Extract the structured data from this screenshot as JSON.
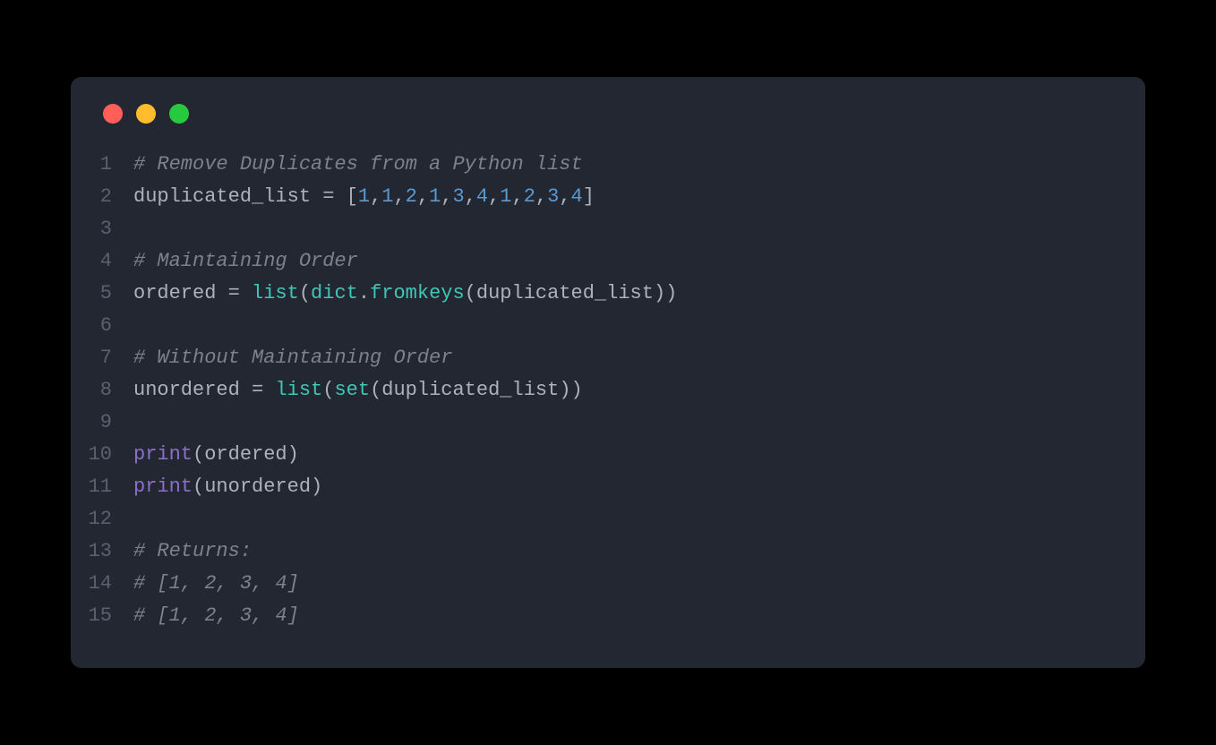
{
  "window": {
    "dots": [
      "red",
      "yellow",
      "green"
    ]
  },
  "code": {
    "lines": [
      {
        "num": "1",
        "tokens": [
          {
            "text": "# Remove Duplicates from a Python list",
            "cls": "tok-comment"
          }
        ]
      },
      {
        "num": "2",
        "tokens": [
          {
            "text": "duplicated_list",
            "cls": "tok-default"
          },
          {
            "text": " ",
            "cls": "tok-default"
          },
          {
            "text": "=",
            "cls": "tok-operator"
          },
          {
            "text": " ",
            "cls": "tok-default"
          },
          {
            "text": "[",
            "cls": "tok-punct"
          },
          {
            "text": "1",
            "cls": "tok-number"
          },
          {
            "text": ",",
            "cls": "tok-punct"
          },
          {
            "text": "1",
            "cls": "tok-number"
          },
          {
            "text": ",",
            "cls": "tok-punct"
          },
          {
            "text": "2",
            "cls": "tok-number"
          },
          {
            "text": ",",
            "cls": "tok-punct"
          },
          {
            "text": "1",
            "cls": "tok-number"
          },
          {
            "text": ",",
            "cls": "tok-punct"
          },
          {
            "text": "3",
            "cls": "tok-number"
          },
          {
            "text": ",",
            "cls": "tok-punct"
          },
          {
            "text": "4",
            "cls": "tok-number"
          },
          {
            "text": ",",
            "cls": "tok-punct"
          },
          {
            "text": "1",
            "cls": "tok-number"
          },
          {
            "text": ",",
            "cls": "tok-punct"
          },
          {
            "text": "2",
            "cls": "tok-number"
          },
          {
            "text": ",",
            "cls": "tok-punct"
          },
          {
            "text": "3",
            "cls": "tok-number"
          },
          {
            "text": ",",
            "cls": "tok-punct"
          },
          {
            "text": "4",
            "cls": "tok-number"
          },
          {
            "text": "]",
            "cls": "tok-punct"
          }
        ]
      },
      {
        "num": "3",
        "tokens": []
      },
      {
        "num": "4",
        "tokens": [
          {
            "text": "# Maintaining Order",
            "cls": "tok-comment"
          }
        ]
      },
      {
        "num": "5",
        "tokens": [
          {
            "text": "ordered",
            "cls": "tok-default"
          },
          {
            "text": " ",
            "cls": "tok-default"
          },
          {
            "text": "=",
            "cls": "tok-operator"
          },
          {
            "text": " ",
            "cls": "tok-default"
          },
          {
            "text": "list",
            "cls": "tok-builtin"
          },
          {
            "text": "(",
            "cls": "tok-punct"
          },
          {
            "text": "dict",
            "cls": "tok-builtin"
          },
          {
            "text": ".",
            "cls": "tok-punct"
          },
          {
            "text": "fromkeys",
            "cls": "tok-func"
          },
          {
            "text": "(",
            "cls": "tok-punct"
          },
          {
            "text": "duplicated_list",
            "cls": "tok-default"
          },
          {
            "text": "))",
            "cls": "tok-punct"
          }
        ]
      },
      {
        "num": "6",
        "tokens": []
      },
      {
        "num": "7",
        "tokens": [
          {
            "text": "# Without Maintaining Order",
            "cls": "tok-comment"
          }
        ]
      },
      {
        "num": "8",
        "tokens": [
          {
            "text": "unordered",
            "cls": "tok-default"
          },
          {
            "text": " ",
            "cls": "tok-default"
          },
          {
            "text": "=",
            "cls": "tok-operator"
          },
          {
            "text": " ",
            "cls": "tok-default"
          },
          {
            "text": "list",
            "cls": "tok-builtin"
          },
          {
            "text": "(",
            "cls": "tok-punct"
          },
          {
            "text": "set",
            "cls": "tok-builtin"
          },
          {
            "text": "(",
            "cls": "tok-punct"
          },
          {
            "text": "duplicated_list",
            "cls": "tok-default"
          },
          {
            "text": "))",
            "cls": "tok-punct"
          }
        ]
      },
      {
        "num": "9",
        "tokens": []
      },
      {
        "num": "10",
        "tokens": [
          {
            "text": "print",
            "cls": "tok-keyword"
          },
          {
            "text": "(",
            "cls": "tok-punct"
          },
          {
            "text": "ordered",
            "cls": "tok-default"
          },
          {
            "text": ")",
            "cls": "tok-punct"
          }
        ]
      },
      {
        "num": "11",
        "tokens": [
          {
            "text": "print",
            "cls": "tok-keyword"
          },
          {
            "text": "(",
            "cls": "tok-punct"
          },
          {
            "text": "unordered",
            "cls": "tok-default"
          },
          {
            "text": ")",
            "cls": "tok-punct"
          }
        ]
      },
      {
        "num": "12",
        "tokens": []
      },
      {
        "num": "13",
        "tokens": [
          {
            "text": "# Returns:",
            "cls": "tok-comment"
          }
        ]
      },
      {
        "num": "14",
        "tokens": [
          {
            "text": "# [1, 2, 3, 4]",
            "cls": "tok-comment"
          }
        ]
      },
      {
        "num": "15",
        "tokens": [
          {
            "text": "# [1, 2, 3, 4]",
            "cls": "tok-comment"
          }
        ]
      }
    ]
  }
}
